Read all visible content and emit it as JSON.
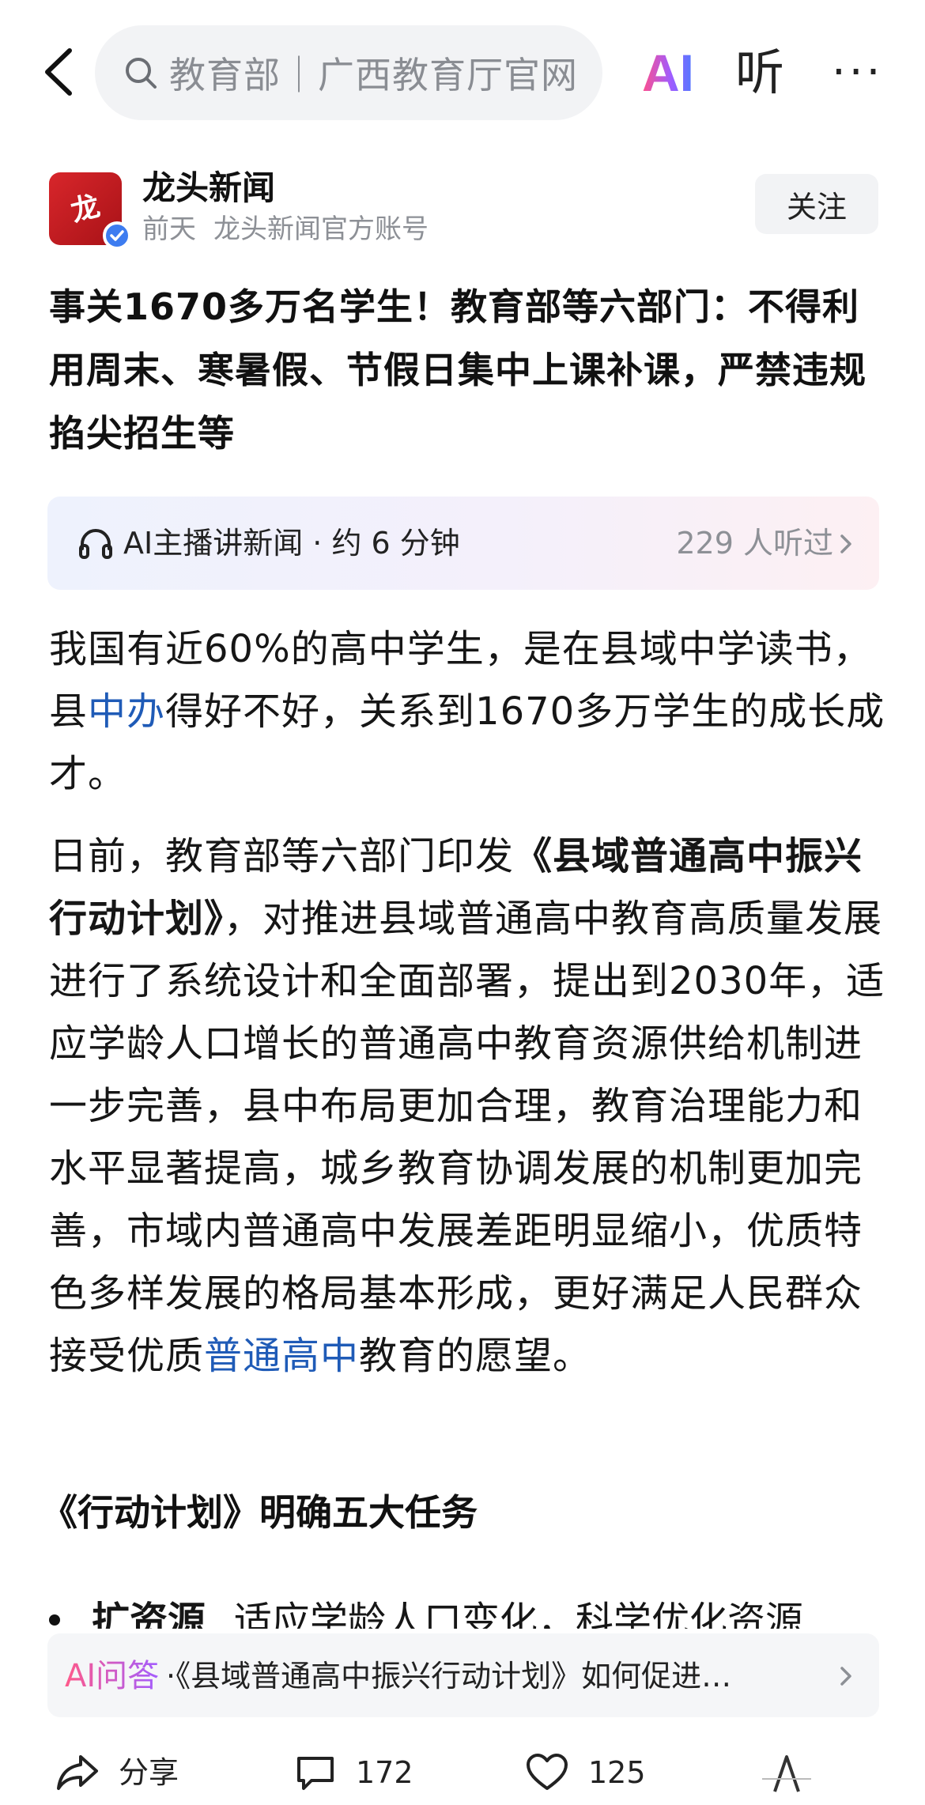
{
  "topbar": {
    "search_text": "教育部｜广西教育厅官网",
    "ai_label": "AI",
    "listen_label": "听",
    "more_label": "···"
  },
  "author": {
    "name": "龙头新闻",
    "time": "前天",
    "desc": "龙头新闻官方账号",
    "follow_label": "关注"
  },
  "article": {
    "title": "事关1670多万名学生！教育部等六部门：不得利用周末、寒暑假、节假日集中上课补课，严禁违规掐尖招生等",
    "player_text": "AI主播讲新闻 · 约 6 分钟",
    "player_count": "229 人听过",
    "p1_a": "我国有近60%的高中学生，是在县域中学读书，县",
    "p1_link": "中办",
    "p1_b": "得好不好，关系到1670多万学生的成长成才。",
    "p2_a": "日前，教育部等六部门印发",
    "p2_strong": "《县域普通高中振兴行动计划》",
    "p2_b": "，对推进县域普通高中教育高质量发展进行了系统设计和全面部署，提出到2030年，适应学龄人口增长的普通高中教育资源供给机制进一步完善，县中布局更加合理，教育治理能力和水平显著提高，城乡教育协调发展的机制更加完善，市域内普通高中发展差距明显缩小，优质特色多样发展的格局基本形成，更好满足人民群众接受优质",
    "p2_link": "普通高中",
    "p2_c": "教育的愿望。",
    "heading": "《行动计划》明确五大任务",
    "bullet_strong": "扩资源",
    "bullet_text": "适应学龄人口变化，科学优化资源"
  },
  "qa": {
    "label": "AI问答",
    "text": "·《县域普通高中振兴行动计划》如何促进…"
  },
  "bottombar": {
    "share_label": "分享",
    "comment_count": "172",
    "like_count": "125"
  },
  "icons": {
    "back": "back-arrow-icon",
    "search": "search-icon",
    "headphones": "headphones-icon",
    "chevron": "chevron-right-icon",
    "share": "share-icon",
    "comment": "comment-icon",
    "like": "heart-icon"
  }
}
